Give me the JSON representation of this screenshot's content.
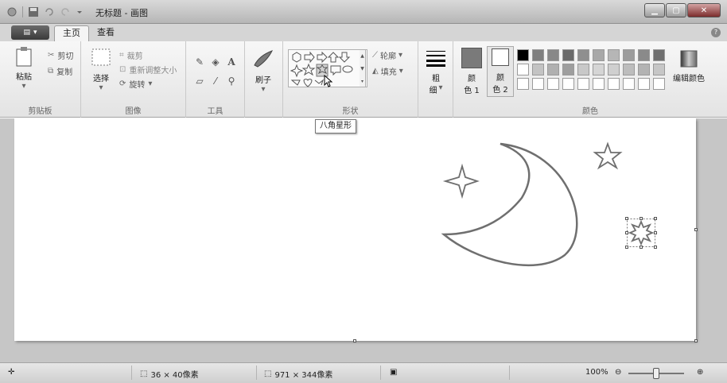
{
  "window": {
    "title": "无标题 - 画图"
  },
  "tabs": {
    "home": "主页",
    "view": "查看"
  },
  "ribbon": {
    "clipboard": {
      "label": "剪贴板",
      "paste": "粘贴",
      "cut": "剪切",
      "copy": "复制"
    },
    "image": {
      "label": "图像",
      "select": "选择",
      "crop": "裁剪",
      "resize": "重新调整大小",
      "rotate": "旋转"
    },
    "tools": {
      "label": "工具"
    },
    "brushes": {
      "label": "刷子"
    },
    "shapes": {
      "label": "形状",
      "outline": "轮廓",
      "fill": "填充"
    },
    "size": {
      "label_line1": "粗",
      "label_line2": "细"
    },
    "colors": {
      "label": "颜色",
      "color1_line1": "颜",
      "color1_line2": "色 1",
      "color2_line1": "颜",
      "color2_line2": "色 2",
      "edit": "编辑颜色",
      "color1_value": "#7a7a7a",
      "color2_value": "#ffffff",
      "palette_row1": [
        "#000000",
        "#7f7f7f",
        "#888888",
        "#6a6a6a",
        "#8f8f8f",
        "#a8a8a8",
        "#b6b6b6",
        "#9c9c9c",
        "#8a8a8a",
        "#6f6f6f"
      ],
      "palette_row2": [
        "#ffffff",
        "#c3c3c3",
        "#b0b0b0",
        "#9e9e9e",
        "#c8c8c8",
        "#d5d5d5",
        "#cfcfcf",
        "#bdbdbd",
        "#b3b3b3",
        "#c6c6c6"
      ]
    }
  },
  "tooltip": {
    "text": "八角星形"
  },
  "statusbar": {
    "selection_size": "36 × 40像素",
    "canvas_size": "971 × 344像素",
    "zoom": "100%",
    "zoom_level": 1.0
  }
}
